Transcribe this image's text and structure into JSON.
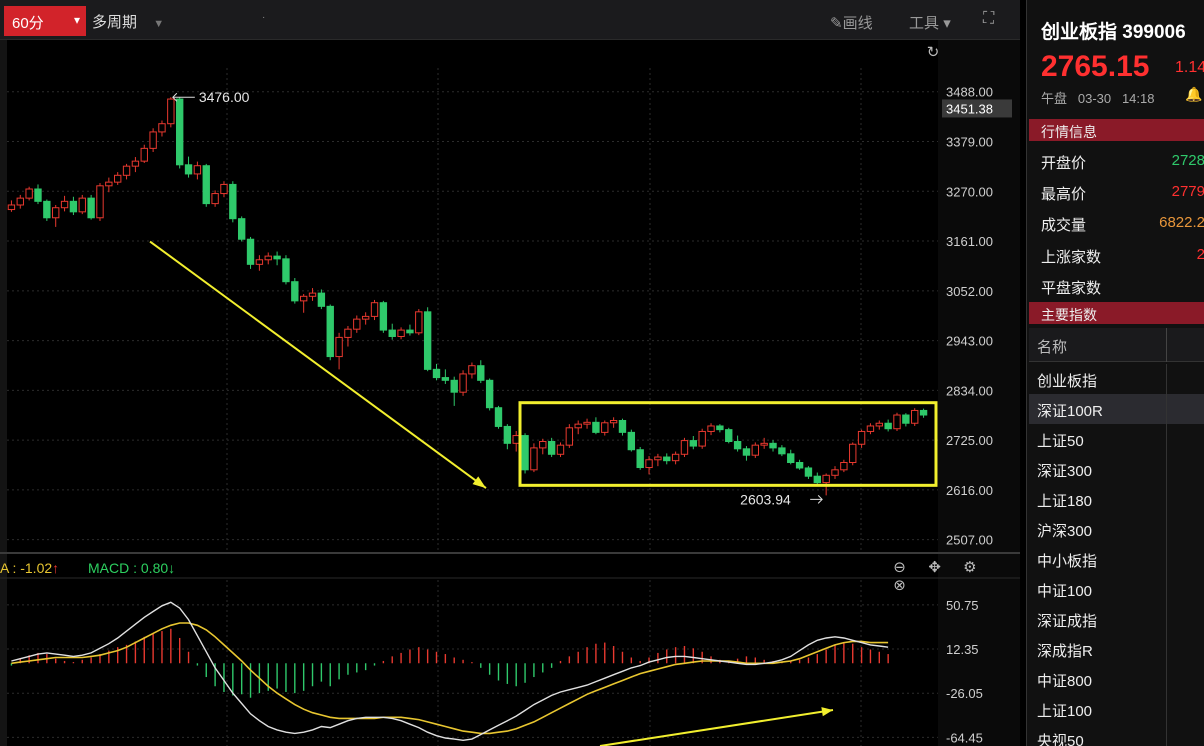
{
  "toolbar": {
    "period": "60分",
    "multi_period": "多周期",
    "draw_line": "画线",
    "tools": "工具"
  },
  "main_chart": {
    "price_ticks": [
      "3488.00",
      "3379.00",
      "3270.00",
      "3161.00",
      "3052.00",
      "2943.00",
      "2834.00",
      "2725.00",
      "2616.00",
      "2507.00"
    ],
    "current_price_label": "3451.38",
    "high_label": "3476.00",
    "low_label": "2603.94"
  },
  "macd": {
    "dif_label": "A : -1.02",
    "macd_label": "MACD : 0.80",
    "ticks": [
      "50.75",
      "12.35",
      "-26.05",
      "-64.45"
    ]
  },
  "side": {
    "name": "创业板指 399006",
    "price": "2765.15",
    "change": "1.14",
    "session": "午盘",
    "date": "03-30",
    "time": "14:18",
    "quote_header": "行情信息",
    "quote_rows": [
      {
        "label": "开盘价",
        "value": "2728"
      },
      {
        "label": "最高价",
        "value": "2779"
      },
      {
        "label": "成交量",
        "value": "6822.2"
      },
      {
        "label": "上涨家数",
        "value": "2"
      },
      {
        "label": "平盘家数",
        "value": ""
      }
    ],
    "index_header": "主要指数",
    "list_header": "名称",
    "indices": [
      "创业板指",
      "深证100R",
      "上证50",
      "深证300",
      "上证180",
      "沪深300",
      "中小板指",
      "中证100",
      "深证成指",
      "深成指R",
      "中证800",
      "上证100",
      "央视50"
    ]
  },
  "colors": {
    "up": "#e8392f",
    "down": "#2fc96b",
    "ma_fast": "#e0e0e0",
    "ma_slow": "#e8c630",
    "annotation": "#f2ef2e",
    "panel_header": "#8a1a28"
  },
  "chart_data": {
    "type": "candlestick",
    "title": "",
    "period": "60分",
    "y_range": [
      2480,
      3540
    ],
    "annotations": {
      "high": 3476.0,
      "low": 2603.94,
      "trend_arrow": {
        "from_price": 3160,
        "to_price": 2620,
        "direction": "down"
      },
      "range_box": {
        "top_price": 2807,
        "bottom_price": 2626
      }
    },
    "candles": [
      {
        "o": 3230,
        "h": 3250,
        "l": 3225,
        "c": 3240
      },
      {
        "o": 3240,
        "h": 3262,
        "l": 3232,
        "c": 3255
      },
      {
        "o": 3255,
        "h": 3280,
        "l": 3250,
        "c": 3275
      },
      {
        "o": 3275,
        "h": 3285,
        "l": 3242,
        "c": 3248
      },
      {
        "o": 3248,
        "h": 3252,
        "l": 3205,
        "c": 3212
      },
      {
        "o": 3212,
        "h": 3240,
        "l": 3192,
        "c": 3234
      },
      {
        "o": 3234,
        "h": 3260,
        "l": 3226,
        "c": 3248
      },
      {
        "o": 3248,
        "h": 3258,
        "l": 3218,
        "c": 3225
      },
      {
        "o": 3225,
        "h": 3262,
        "l": 3220,
        "c": 3255
      },
      {
        "o": 3255,
        "h": 3262,
        "l": 3208,
        "c": 3212
      },
      {
        "o": 3212,
        "h": 3288,
        "l": 3205,
        "c": 3282
      },
      {
        "o": 3282,
        "h": 3300,
        "l": 3268,
        "c": 3290
      },
      {
        "o": 3290,
        "h": 3312,
        "l": 3284,
        "c": 3305
      },
      {
        "o": 3305,
        "h": 3330,
        "l": 3296,
        "c": 3325
      },
      {
        "o": 3325,
        "h": 3345,
        "l": 3312,
        "c": 3336
      },
      {
        "o": 3336,
        "h": 3372,
        "l": 3332,
        "c": 3364
      },
      {
        "o": 3364,
        "h": 3408,
        "l": 3356,
        "c": 3400
      },
      {
        "o": 3400,
        "h": 3425,
        "l": 3390,
        "c": 3418
      },
      {
        "o": 3418,
        "h": 3476,
        "l": 3410,
        "c": 3472
      },
      {
        "o": 3472,
        "h": 3476,
        "l": 3320,
        "c": 3328
      },
      {
        "o": 3328,
        "h": 3346,
        "l": 3300,
        "c": 3308
      },
      {
        "o": 3308,
        "h": 3335,
        "l": 3296,
        "c": 3326
      },
      {
        "o": 3326,
        "h": 3330,
        "l": 3236,
        "c": 3243
      },
      {
        "o": 3243,
        "h": 3272,
        "l": 3236,
        "c": 3265
      },
      {
        "o": 3265,
        "h": 3292,
        "l": 3257,
        "c": 3285
      },
      {
        "o": 3285,
        "h": 3292,
        "l": 3202,
        "c": 3210
      },
      {
        "o": 3210,
        "h": 3215,
        "l": 3160,
        "c": 3165
      },
      {
        "o": 3165,
        "h": 3170,
        "l": 3100,
        "c": 3110
      },
      {
        "o": 3110,
        "h": 3130,
        "l": 3096,
        "c": 3120
      },
      {
        "o": 3120,
        "h": 3136,
        "l": 3110,
        "c": 3128
      },
      {
        "o": 3128,
        "h": 3138,
        "l": 3108,
        "c": 3122
      },
      {
        "o": 3122,
        "h": 3130,
        "l": 3066,
        "c": 3072
      },
      {
        "o": 3072,
        "h": 3080,
        "l": 3024,
        "c": 3030
      },
      {
        "o": 3030,
        "h": 3045,
        "l": 3004,
        "c": 3040
      },
      {
        "o": 3040,
        "h": 3058,
        "l": 3030,
        "c": 3047
      },
      {
        "o": 3047,
        "h": 3055,
        "l": 3012,
        "c": 3018
      },
      {
        "o": 3018,
        "h": 3022,
        "l": 2900,
        "c": 2908
      },
      {
        "o": 2908,
        "h": 2960,
        "l": 2880,
        "c": 2950
      },
      {
        "o": 2950,
        "h": 2975,
        "l": 2930,
        "c": 2968
      },
      {
        "o": 2968,
        "h": 2998,
        "l": 2960,
        "c": 2990
      },
      {
        "o": 2990,
        "h": 3005,
        "l": 2978,
        "c": 2996
      },
      {
        "o": 2996,
        "h": 3032,
        "l": 2988,
        "c": 3026
      },
      {
        "o": 3026,
        "h": 3030,
        "l": 2960,
        "c": 2966
      },
      {
        "o": 2966,
        "h": 2980,
        "l": 2945,
        "c": 2952
      },
      {
        "o": 2952,
        "h": 2972,
        "l": 2946,
        "c": 2966
      },
      {
        "o": 2966,
        "h": 2978,
        "l": 2954,
        "c": 2960
      },
      {
        "o": 2960,
        "h": 3012,
        "l": 2955,
        "c": 3006
      },
      {
        "o": 3006,
        "h": 3016,
        "l": 2876,
        "c": 2880
      },
      {
        "o": 2880,
        "h": 2892,
        "l": 2856,
        "c": 2862
      },
      {
        "o": 2862,
        "h": 2880,
        "l": 2848,
        "c": 2856
      },
      {
        "o": 2856,
        "h": 2864,
        "l": 2800,
        "c": 2830
      },
      {
        "o": 2830,
        "h": 2878,
        "l": 2822,
        "c": 2870
      },
      {
        "o": 2870,
        "h": 2895,
        "l": 2860,
        "c": 2888
      },
      {
        "o": 2888,
        "h": 2900,
        "l": 2850,
        "c": 2856
      },
      {
        "o": 2856,
        "h": 2860,
        "l": 2790,
        "c": 2796
      },
      {
        "o": 2796,
        "h": 2800,
        "l": 2750,
        "c": 2755
      },
      {
        "o": 2755,
        "h": 2760,
        "l": 2705,
        "c": 2718
      },
      {
        "o": 2718,
        "h": 2745,
        "l": 2700,
        "c": 2735
      },
      {
        "o": 2735,
        "h": 2740,
        "l": 2652,
        "c": 2660
      },
      {
        "o": 2660,
        "h": 2718,
        "l": 2655,
        "c": 2708
      },
      {
        "o": 2708,
        "h": 2728,
        "l": 2694,
        "c": 2722
      },
      {
        "o": 2722,
        "h": 2730,
        "l": 2688,
        "c": 2694
      },
      {
        "o": 2694,
        "h": 2720,
        "l": 2688,
        "c": 2714
      },
      {
        "o": 2714,
        "h": 2760,
        "l": 2708,
        "c": 2752
      },
      {
        "o": 2752,
        "h": 2768,
        "l": 2738,
        "c": 2760
      },
      {
        "o": 2760,
        "h": 2772,
        "l": 2750,
        "c": 2764
      },
      {
        "o": 2764,
        "h": 2775,
        "l": 2738,
        "c": 2742
      },
      {
        "o": 2742,
        "h": 2768,
        "l": 2735,
        "c": 2763
      },
      {
        "o": 2763,
        "h": 2775,
        "l": 2752,
        "c": 2768
      },
      {
        "o": 2768,
        "h": 2772,
        "l": 2735,
        "c": 2742
      },
      {
        "o": 2742,
        "h": 2748,
        "l": 2700,
        "c": 2704
      },
      {
        "o": 2704,
        "h": 2710,
        "l": 2660,
        "c": 2665
      },
      {
        "o": 2665,
        "h": 2690,
        "l": 2650,
        "c": 2682
      },
      {
        "o": 2682,
        "h": 2695,
        "l": 2668,
        "c": 2688
      },
      {
        "o": 2688,
        "h": 2696,
        "l": 2672,
        "c": 2680
      },
      {
        "o": 2680,
        "h": 2700,
        "l": 2672,
        "c": 2694
      },
      {
        "o": 2694,
        "h": 2730,
        "l": 2688,
        "c": 2724
      },
      {
        "o": 2724,
        "h": 2734,
        "l": 2705,
        "c": 2712
      },
      {
        "o": 2712,
        "h": 2750,
        "l": 2706,
        "c": 2744
      },
      {
        "o": 2744,
        "h": 2762,
        "l": 2736,
        "c": 2756
      },
      {
        "o": 2756,
        "h": 2760,
        "l": 2742,
        "c": 2748
      },
      {
        "o": 2748,
        "h": 2752,
        "l": 2718,
        "c": 2722
      },
      {
        "o": 2722,
        "h": 2735,
        "l": 2700,
        "c": 2706
      },
      {
        "o": 2706,
        "h": 2712,
        "l": 2680,
        "c": 2692
      },
      {
        "o": 2692,
        "h": 2720,
        "l": 2686,
        "c": 2714
      },
      {
        "o": 2714,
        "h": 2730,
        "l": 2706,
        "c": 2718
      },
      {
        "o": 2718,
        "h": 2725,
        "l": 2700,
        "c": 2708
      },
      {
        "o": 2708,
        "h": 2714,
        "l": 2690,
        "c": 2695
      },
      {
        "o": 2695,
        "h": 2704,
        "l": 2672,
        "c": 2676
      },
      {
        "o": 2676,
        "h": 2682,
        "l": 2660,
        "c": 2664
      },
      {
        "o": 2664,
        "h": 2668,
        "l": 2640,
        "c": 2646
      },
      {
        "o": 2646,
        "h": 2654,
        "l": 2628,
        "c": 2632
      },
      {
        "o": 2632,
        "h": 2652,
        "l": 2604,
        "c": 2648
      },
      {
        "o": 2648,
        "h": 2668,
        "l": 2640,
        "c": 2660
      },
      {
        "o": 2660,
        "h": 2682,
        "l": 2655,
        "c": 2676
      },
      {
        "o": 2676,
        "h": 2720,
        "l": 2670,
        "c": 2716
      },
      {
        "o": 2716,
        "h": 2748,
        "l": 2708,
        "c": 2744
      },
      {
        "o": 2744,
        "h": 2762,
        "l": 2738,
        "c": 2756
      },
      {
        "o": 2756,
        "h": 2768,
        "l": 2748,
        "c": 2762
      },
      {
        "o": 2762,
        "h": 2770,
        "l": 2744,
        "c": 2750
      },
      {
        "o": 2750,
        "h": 2785,
        "l": 2745,
        "c": 2780
      },
      {
        "o": 2780,
        "h": 2784,
        "l": 2755,
        "c": 2762
      },
      {
        "o": 2762,
        "h": 2795,
        "l": 2756,
        "c": 2790
      },
      {
        "o": 2790,
        "h": 2794,
        "l": 2774,
        "c": 2780
      }
    ],
    "macd_range": [
      -72,
      62
    ],
    "macd_hist": [
      -2,
      4,
      7,
      9,
      8,
      4,
      2,
      1,
      3,
      5,
      8,
      11,
      14,
      16,
      19,
      23,
      26,
      28,
      30,
      22,
      10,
      -2,
      -12,
      -20,
      -25,
      -28,
      -27,
      -30,
      -26,
      -24,
      -22,
      -25,
      -26,
      -24,
      -20,
      -16,
      -20,
      -14,
      -10,
      -8,
      -6,
      -2,
      2,
      6,
      9,
      12,
      14,
      12,
      10,
      8,
      5,
      3,
      1,
      -4,
      -10,
      -15,
      -18,
      -20,
      -17,
      -12,
      -8,
      -4,
      2,
      6,
      10,
      14,
      17,
      18,
      15,
      10,
      5,
      2,
      5,
      9,
      12,
      14,
      15,
      13,
      10,
      6,
      3,
      2,
      4,
      6,
      5,
      3,
      2,
      1,
      2,
      3,
      5,
      8,
      12,
      16,
      18,
      17,
      14,
      12,
      10,
      8
    ],
    "macd_dif": [
      2,
      4,
      6,
      8,
      9,
      8,
      7,
      6,
      7,
      9,
      13,
      17,
      22,
      28,
      34,
      40,
      45,
      50,
      53,
      48,
      38,
      24,
      10,
      -4,
      -15,
      -26,
      -35,
      -44,
      -50,
      -55,
      -58,
      -60,
      -61,
      -60,
      -58,
      -55,
      -56,
      -53,
      -50,
      -48,
      -47,
      -47,
      -47,
      -48,
      -50,
      -53,
      -56,
      -60,
      -63,
      -65,
      -66,
      -67,
      -66,
      -62,
      -58,
      -54,
      -50,
      -46,
      -41,
      -36,
      -32,
      -28,
      -25,
      -23,
      -21,
      -19,
      -16,
      -13,
      -10,
      -7,
      -4,
      -2,
      1,
      3,
      5,
      6,
      6,
      5,
      4,
      3,
      2,
      1,
      0,
      -1,
      -1,
      0,
      1,
      3,
      6,
      11,
      16,
      20,
      22,
      23,
      22,
      20,
      18,
      16,
      15,
      14
    ],
    "macd_dea": [
      0,
      1,
      2,
      3,
      4,
      5,
      5,
      5,
      5,
      6,
      7,
      9,
      11,
      14,
      18,
      22,
      26,
      30,
      33,
      35,
      35,
      33,
      29,
      23,
      16,
      9,
      2,
      -6,
      -13,
      -20,
      -26,
      -31,
      -36,
      -40,
      -43,
      -45,
      -47,
      -48,
      -48,
      -48,
      -48,
      -48,
      -47,
      -47,
      -47,
      -48,
      -49,
      -51,
      -53,
      -55,
      -57,
      -59,
      -60,
      -61,
      -61,
      -60,
      -59,
      -57,
      -54,
      -51,
      -47,
      -43,
      -39,
      -35,
      -31,
      -27,
      -24,
      -21,
      -18,
      -15,
      -12,
      -9,
      -7,
      -5,
      -3,
      -1,
      0,
      1,
      2,
      2,
      2,
      2,
      1,
      0,
      0,
      0,
      0,
      1,
      2,
      4,
      7,
      10,
      13,
      16,
      18,
      19,
      19,
      18,
      18,
      18
    ]
  }
}
